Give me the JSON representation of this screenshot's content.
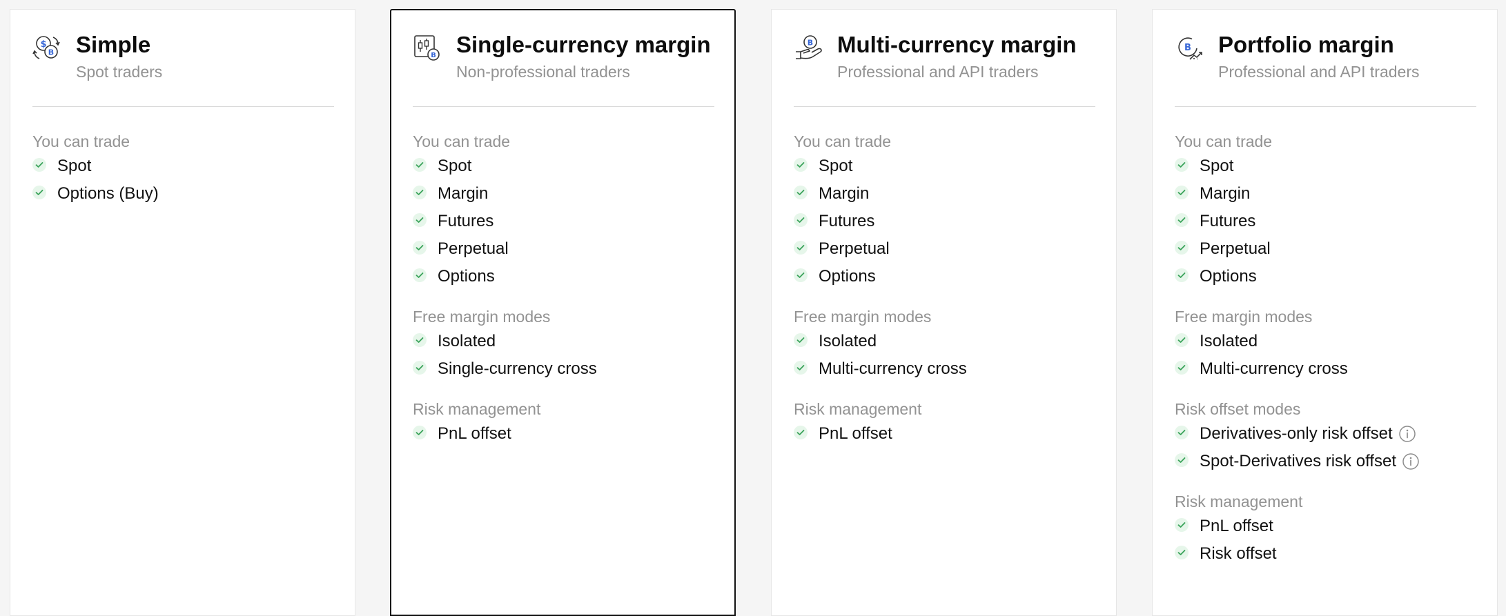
{
  "colors": {
    "background": "#f5f5f5",
    "card": "#ffffff",
    "selected_border": "#111111",
    "check_bg": "#e6f6ea",
    "check_mark": "#3aa35a",
    "muted_text": "#929292",
    "coin_blue": "#3867d6"
  },
  "plans": [
    {
      "icon": "coin-swap-icon",
      "title": "Simple",
      "subtitle": "Spot traders",
      "selected": false,
      "sections": [
        {
          "title": "You can trade",
          "items": [
            {
              "label": "Spot"
            },
            {
              "label": "Options (Buy)"
            }
          ]
        }
      ]
    },
    {
      "icon": "candlestick-coin-icon",
      "title": "Single-currency margin",
      "subtitle": "Non-professional traders",
      "selected": true,
      "sections": [
        {
          "title": "You can trade",
          "items": [
            {
              "label": "Spot"
            },
            {
              "label": "Margin"
            },
            {
              "label": "Futures"
            },
            {
              "label": "Perpetual"
            },
            {
              "label": "Options"
            }
          ]
        },
        {
          "title": "Free margin modes",
          "items": [
            {
              "label": "Isolated"
            },
            {
              "label": "Single-currency cross"
            }
          ]
        },
        {
          "title": "Risk management",
          "items": [
            {
              "label": "PnL offset"
            }
          ]
        }
      ]
    },
    {
      "icon": "hand-coin-icon",
      "title": "Multi-currency margin",
      "subtitle": "Professional and API traders",
      "selected": false,
      "sections": [
        {
          "title": "You can trade",
          "items": [
            {
              "label": "Spot"
            },
            {
              "label": "Margin"
            },
            {
              "label": "Futures"
            },
            {
              "label": "Perpetual"
            },
            {
              "label": "Options"
            }
          ]
        },
        {
          "title": "Free margin modes",
          "items": [
            {
              "label": "Isolated"
            },
            {
              "label": "Multi-currency cross"
            }
          ]
        },
        {
          "title": "Risk management",
          "items": [
            {
              "label": "PnL offset"
            }
          ]
        }
      ]
    },
    {
      "icon": "coin-chart-icon",
      "title": "Portfolio margin",
      "subtitle": "Professional and API traders",
      "selected": false,
      "sections": [
        {
          "title": "You can trade",
          "items": [
            {
              "label": "Spot"
            },
            {
              "label": "Margin"
            },
            {
              "label": "Futures"
            },
            {
              "label": "Perpetual"
            },
            {
              "label": "Options"
            }
          ]
        },
        {
          "title": "Free margin modes",
          "items": [
            {
              "label": "Isolated"
            },
            {
              "label": "Multi-currency cross"
            }
          ]
        },
        {
          "title": "Risk offset modes",
          "items": [
            {
              "label": "Derivatives-only risk offset",
              "info": true
            },
            {
              "label": "Spot-Derivatives risk offset",
              "info": true
            }
          ]
        },
        {
          "title": "Risk management",
          "items": [
            {
              "label": "PnL offset"
            },
            {
              "label": "Risk offset"
            }
          ]
        }
      ]
    }
  ]
}
